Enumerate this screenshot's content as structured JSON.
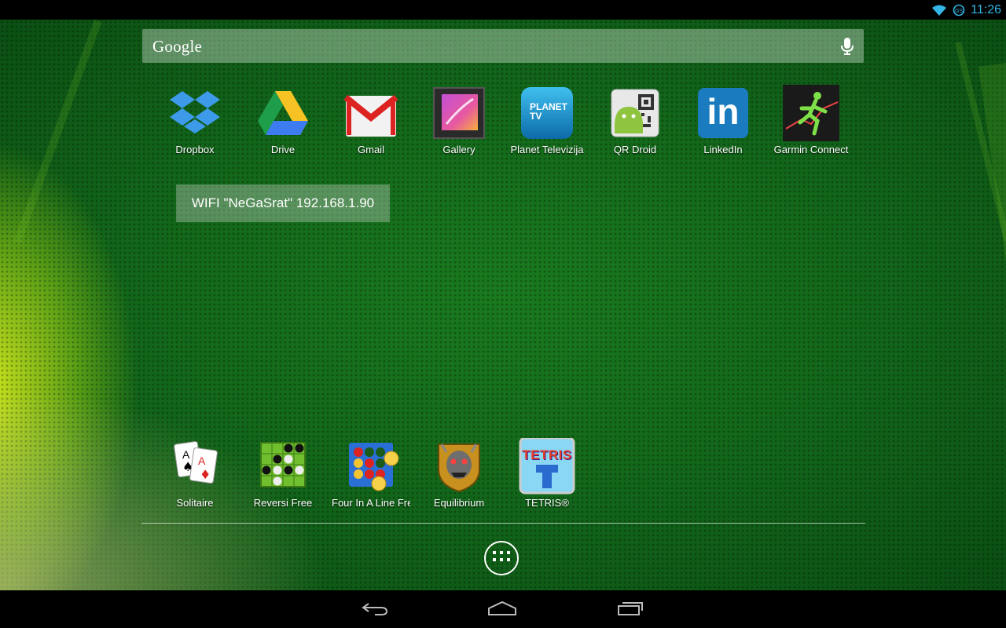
{
  "status_bar": {
    "time": "11:26",
    "icons": [
      "wifi-icon",
      "sync-icon"
    ],
    "accent_color": "#33b5e5"
  },
  "search": {
    "logo_text": "Google",
    "mic_icon": "mic-icon"
  },
  "apps_top": [
    {
      "label": "Dropbox",
      "icon": "dropbox-icon"
    },
    {
      "label": "Drive",
      "icon": "drive-icon"
    },
    {
      "label": "Gmail",
      "icon": "gmail-icon"
    },
    {
      "label": "Gallery",
      "icon": "gallery-icon"
    },
    {
      "label": "Planet Televizija",
      "icon": "planet-tv-icon",
      "icon_text": "PLANET TV"
    },
    {
      "label": "QR Droid",
      "icon": "qr-droid-icon"
    },
    {
      "label": "LinkedIn",
      "icon": "linkedin-icon",
      "icon_text": "in"
    },
    {
      "label": "Garmin Connect",
      "icon": "garmin-connect-icon"
    }
  ],
  "widget": {
    "text": "WIFI \"NeGaSrat\" 192.168.1.90"
  },
  "apps_bottom": [
    {
      "label": "Solitaire",
      "icon": "solitaire-icon"
    },
    {
      "label": "Reversi Free",
      "icon": "reversi-icon"
    },
    {
      "label": "Four In A Line Free",
      "icon": "four-in-a-line-icon"
    },
    {
      "label": "Equilibrium",
      "icon": "equilibrium-icon"
    },
    {
      "label": "TETRIS®",
      "icon": "tetris-icon",
      "icon_text": "TETRIS"
    }
  ],
  "nav_bar": {
    "buttons": [
      "back-icon",
      "home-icon",
      "recent-apps-icon"
    ]
  },
  "all_apps_icon": "app-drawer-icon"
}
